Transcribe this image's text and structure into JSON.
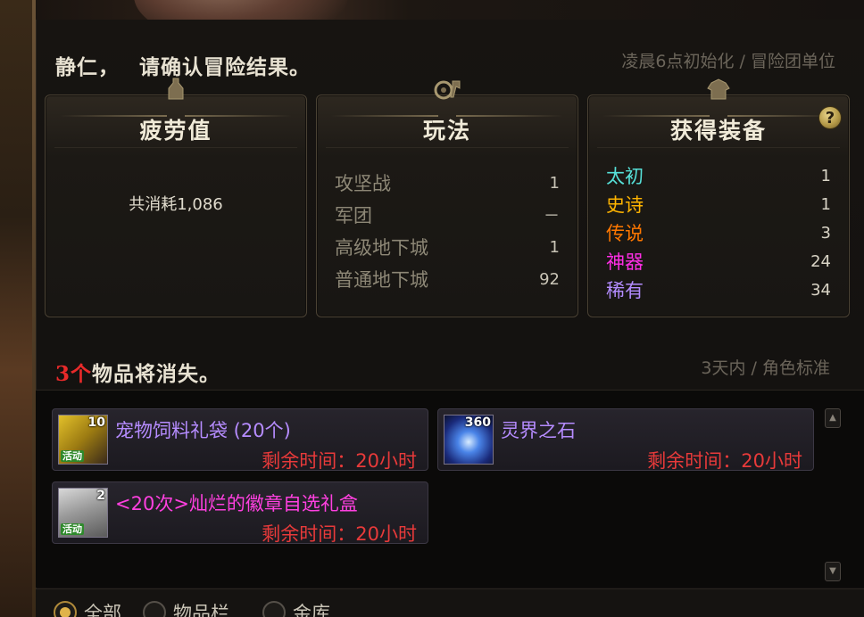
{
  "header": {
    "player_name": "静仁，",
    "prompt": "请确认冒险结果。",
    "reset_info": "凌晨6点初始化 / 冒险团单位"
  },
  "cards": {
    "fatigue": {
      "title": "疲劳值",
      "text": "共消耗1,086"
    },
    "mode": {
      "title": "玩法",
      "rows": [
        {
          "label": "攻坚战",
          "value": "1"
        },
        {
          "label": "军团",
          "value": "－"
        },
        {
          "label": "高级地下城",
          "value": "1"
        },
        {
          "label": "普通地下城",
          "value": "92"
        }
      ]
    },
    "equipment": {
      "title": "获得装备",
      "help": "?",
      "rows": [
        {
          "label": "太初",
          "value": "1",
          "color": "#56e0d8"
        },
        {
          "label": "史诗",
          "value": "1",
          "color": "#ffb400"
        },
        {
          "label": "传说",
          "value": "3",
          "color": "#ff7800"
        },
        {
          "label": "神器",
          "value": "24",
          "color": "#ff2ee6"
        },
        {
          "label": "稀有",
          "value": "34",
          "color": "#b38cff"
        }
      ]
    }
  },
  "expiring": {
    "count": "3个",
    "title_rest": "物品将消失。",
    "info": "3天内 / 角色标准",
    "items": [
      {
        "name": "宠物饲料礼袋 (20个)",
        "qty": "10",
        "tag": "活动",
        "remaining": "剩余时间：20小时",
        "icon": "pet-food-bag-icon"
      },
      {
        "name": "灵界之石",
        "qty": "360",
        "tag": "",
        "remaining": "剩余时间：20小时",
        "icon": "spirit-stone-icon"
      },
      {
        "name": "<20次>灿烂的徽章自选礼盒",
        "qty": "2",
        "tag": "活动",
        "remaining": "剩余时间：20小时",
        "icon": "emblem-box-icon"
      }
    ]
  },
  "filters": {
    "options": [
      "全部",
      "物品栏",
      "金库"
    ],
    "selected": "全部"
  },
  "icons": {
    "scroll_up": "chevron-up-icon",
    "scroll_down": "chevron-down-icon"
  }
}
